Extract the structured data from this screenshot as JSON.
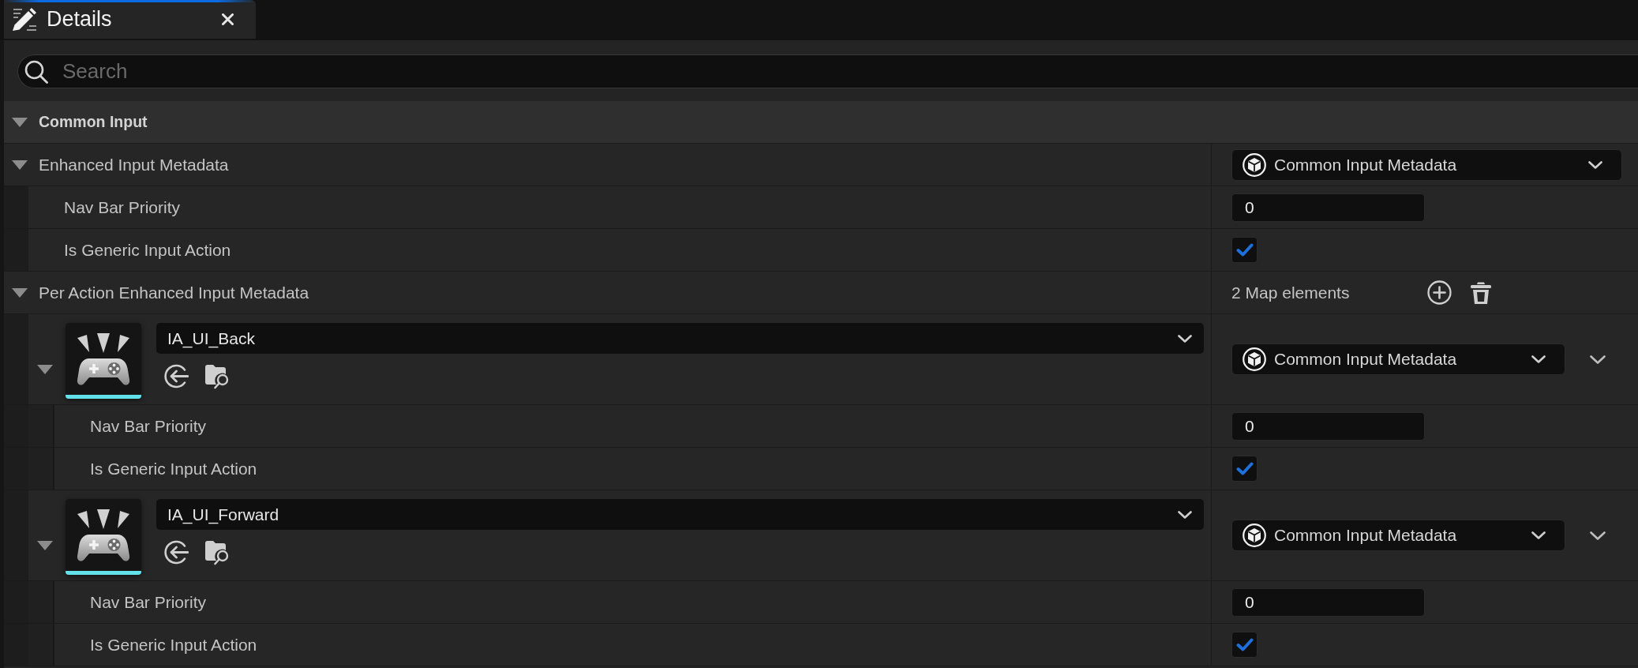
{
  "tab": {
    "title": "Details",
    "selected": true
  },
  "search": {
    "placeholder": "Search"
  },
  "category": {
    "label": "Common Input",
    "expanded": true
  },
  "properties": [
    {
      "kind": "object",
      "label": "Enhanced Input Metadata",
      "expanded": true,
      "value": "Common Input Metadata",
      "children": [
        {
          "kind": "number",
          "label": "Nav Bar Priority",
          "value": "0"
        },
        {
          "kind": "checkbox",
          "label": "Is Generic Input Action",
          "checked": true
        }
      ]
    },
    {
      "kind": "map",
      "label": "Per Action Enhanced Input Metadata",
      "expanded": true,
      "count": "2 Map elements",
      "entries": [
        {
          "key": "IA_UI_Back",
          "expanded": true,
          "value": "Common Input Metadata",
          "children": [
            {
              "kind": "number",
              "label": "Nav Bar Priority",
              "value": "0"
            },
            {
              "kind": "checkbox",
              "label": "Is Generic Input Action",
              "checked": true
            }
          ]
        },
        {
          "key": "IA_UI_Forward",
          "expanded": true,
          "value": "Common Input Metadata",
          "children": [
            {
              "kind": "number",
              "label": "Nav Bar Priority",
              "value": "0"
            },
            {
              "kind": "checkbox",
              "label": "Is Generic Input Action",
              "checked": true
            }
          ]
        }
      ]
    }
  ]
}
